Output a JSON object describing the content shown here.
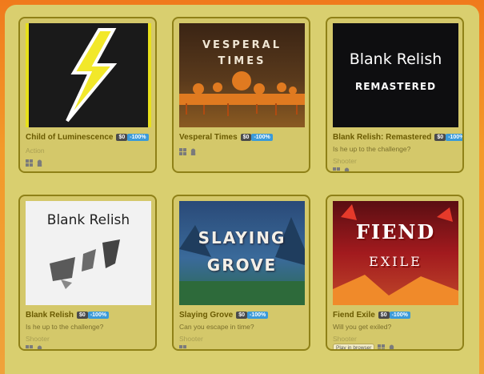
{
  "games": [
    {
      "title": "Child of Luminescence",
      "price": "$0",
      "discount": "-100%",
      "description": "",
      "genre": "Action",
      "platforms": [
        "windows-icon",
        "linux-icon"
      ],
      "thumb_text": ""
    },
    {
      "title": "Vesperal Times",
      "price": "$0",
      "discount": "-100%",
      "description": "",
      "genre": "",
      "platforms": [
        "windows-icon",
        "linux-icon"
      ],
      "thumb_text": "VESPERAL\nTIMES"
    },
    {
      "title": "Blank Relish: Remastered",
      "price": "$0",
      "discount": "-100%",
      "description": "Is he up to the challenge?",
      "genre": "Shooter",
      "platforms": [
        "windows-icon",
        "linux-icon"
      ],
      "thumb_text": "Blank Relish",
      "thumb_subtext": "REMASTERED"
    },
    {
      "title": "Blank Relish",
      "price": "$0",
      "discount": "-100%",
      "description": "Is he up to the challenge?",
      "genre": "Shooter",
      "platforms": [
        "windows-icon",
        "linux-icon"
      ],
      "thumb_text": "Blank Relish"
    },
    {
      "title": "Slaying Grove",
      "price": "$0",
      "discount": "-100%",
      "description": "Can you escape in time?",
      "genre": "Shooter",
      "platforms": [
        "windows-icon"
      ],
      "thumb_text": "SLAYING",
      "thumb_subtext": "GROVE"
    },
    {
      "title": "Fiend Exile",
      "price": "$0",
      "discount": "-100%",
      "description": "Will you get exiled?",
      "genre": "Shooter",
      "platforms": [
        "windows-icon",
        "linux-icon"
      ],
      "browser_label": "Play in browser",
      "thumb_text": "FIEND",
      "thumb_subtext": "EXILE"
    }
  ],
  "colors": {
    "accent": "#3a9ad9",
    "card": "#d4c86a",
    "border": "#8f8118",
    "title": "#6a5a00"
  }
}
